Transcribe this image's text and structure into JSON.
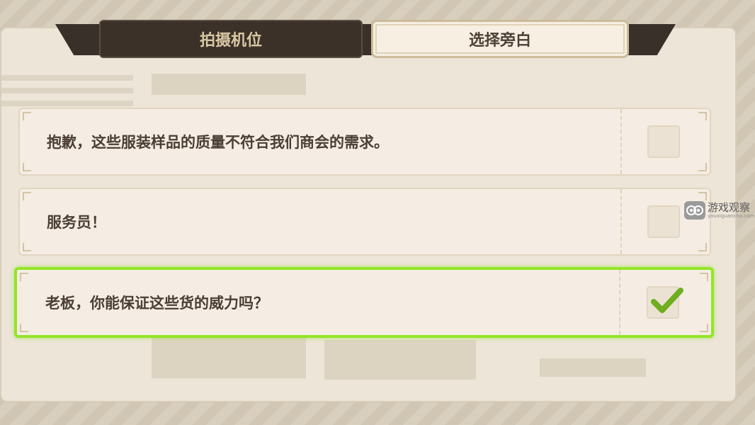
{
  "tabs": [
    {
      "label": "拍摄机位",
      "active": false
    },
    {
      "label": "选择旁白",
      "active": true
    }
  ],
  "options": [
    {
      "text": "抱歉，这些服装样品的质量不符合我们商会的需求。",
      "checked": false
    },
    {
      "text": "服务员！",
      "checked": false
    },
    {
      "text": "老板，你能保证这些货的威力吗？",
      "checked": true
    }
  ],
  "watermark": {
    "title": "游戏观察",
    "subtitle": "youxiguancha.com"
  },
  "colors": {
    "selection": "#93e52a",
    "checkmark": "#6fae1e",
    "tab_dark": "#3b3129",
    "text": "#4b3e34"
  }
}
